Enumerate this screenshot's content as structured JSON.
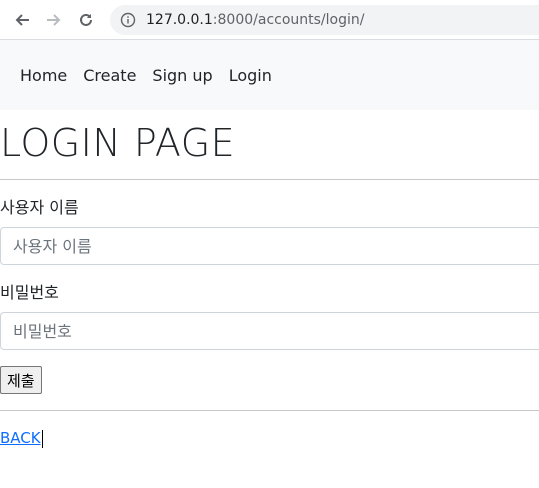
{
  "browser": {
    "url_host": "127.0.0.1",
    "url_rest": ":8000/accounts/login/",
    "icons": [
      "back-arrow-icon",
      "forward-arrow-icon",
      "reload-icon",
      "info-icon"
    ]
  },
  "navbar": {
    "links": [
      {
        "label": "Home"
      },
      {
        "label": "Create"
      },
      {
        "label": "Sign up"
      },
      {
        "label": "Login"
      }
    ]
  },
  "page": {
    "title": "LOGIN PAGE",
    "username_label": "사용자 이름",
    "username_placeholder": "사용자 이름",
    "password_label": "비밀번호",
    "password_placeholder": "비밀번호",
    "submit_label": "제출",
    "back_link": "BACK"
  },
  "colors": {
    "navbar_bg": "#f8f9fa",
    "link": "#0d6efd",
    "text": "#212529"
  }
}
